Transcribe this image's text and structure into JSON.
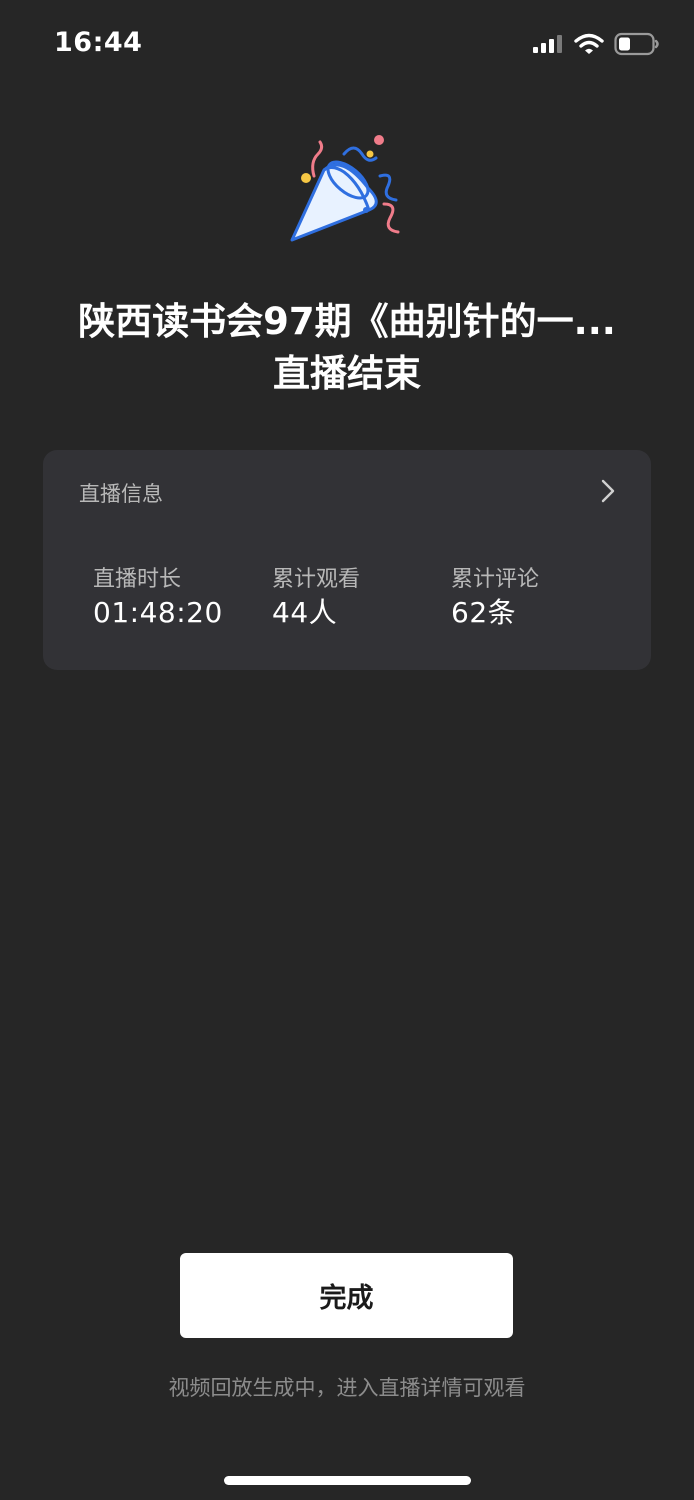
{
  "status_bar": {
    "time": "16:44"
  },
  "header": {
    "title_line1": "陕西读书会97期《曲别针的一...",
    "title_line2": "直播结束"
  },
  "card": {
    "title": "直播信息",
    "stats": [
      {
        "label": "直播时长",
        "value": "01:48:20"
      },
      {
        "label": "累计观看",
        "value": "44人"
      },
      {
        "label": "累计评论",
        "value": "62条"
      }
    ]
  },
  "done_button": {
    "label": "完成"
  },
  "footer": {
    "hint": "视频回放生成中，进入直播详情可观看"
  },
  "icons": [
    "signal-icon",
    "wifi-icon",
    "battery-icon",
    "party-popper-icon",
    "chevron-right-icon"
  ]
}
